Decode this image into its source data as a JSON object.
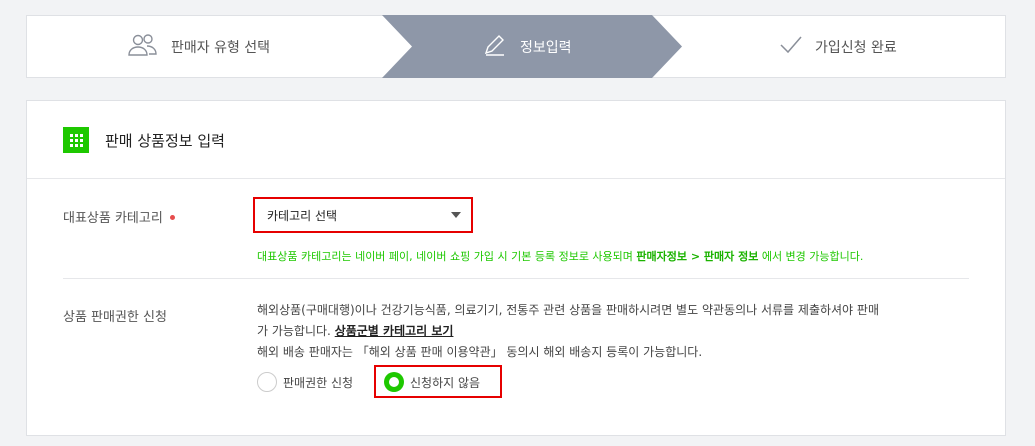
{
  "steps": [
    {
      "label": "판매자 유형 선택",
      "icon": "users-icon"
    },
    {
      "label": "정보입력",
      "icon": "pencil-icon"
    },
    {
      "label": "가입신청 완료",
      "icon": "check-icon"
    }
  ],
  "colors": {
    "accent": "#1ec800",
    "active_step": "#8e97a8",
    "highlight": "#e60000",
    "required": "#e64c4c"
  },
  "section": {
    "title": "판매 상품정보 입력",
    "icon": "grid-icon",
    "category": {
      "label": "대표상품 카테고리",
      "select_value": "카테고리 선택",
      "note_prefix": "대표상품 카테고리는 네이버 페이, 네이버 쇼핑 가입 시 기본 등록 정보로 사용되며 ",
      "note_bold": "판매자정보 > 판매자 정보",
      "note_suffix": " 에서 변경 가능합니다."
    },
    "permission": {
      "label": "상품 판매권한 신청",
      "desc_line1": "해외상품(구매대행)이나 건강기능식품, 의료기기, 전통주 관련 상품을 판매하시려면 별도 약관동의나 서류를 제출하셔야 판매",
      "desc_line2": "가 가능합니다. ",
      "desc_link": "상품군별 카테고리 보기",
      "desc_line3": "해외 배송 판매자는 「해외 상품 판매 이용약관」 동의시 해외 배송지 등록이 가능합니다.",
      "options": [
        {
          "label": "판매권한 신청",
          "selected": false
        },
        {
          "label": "신청하지 않음",
          "selected": true
        }
      ]
    }
  }
}
